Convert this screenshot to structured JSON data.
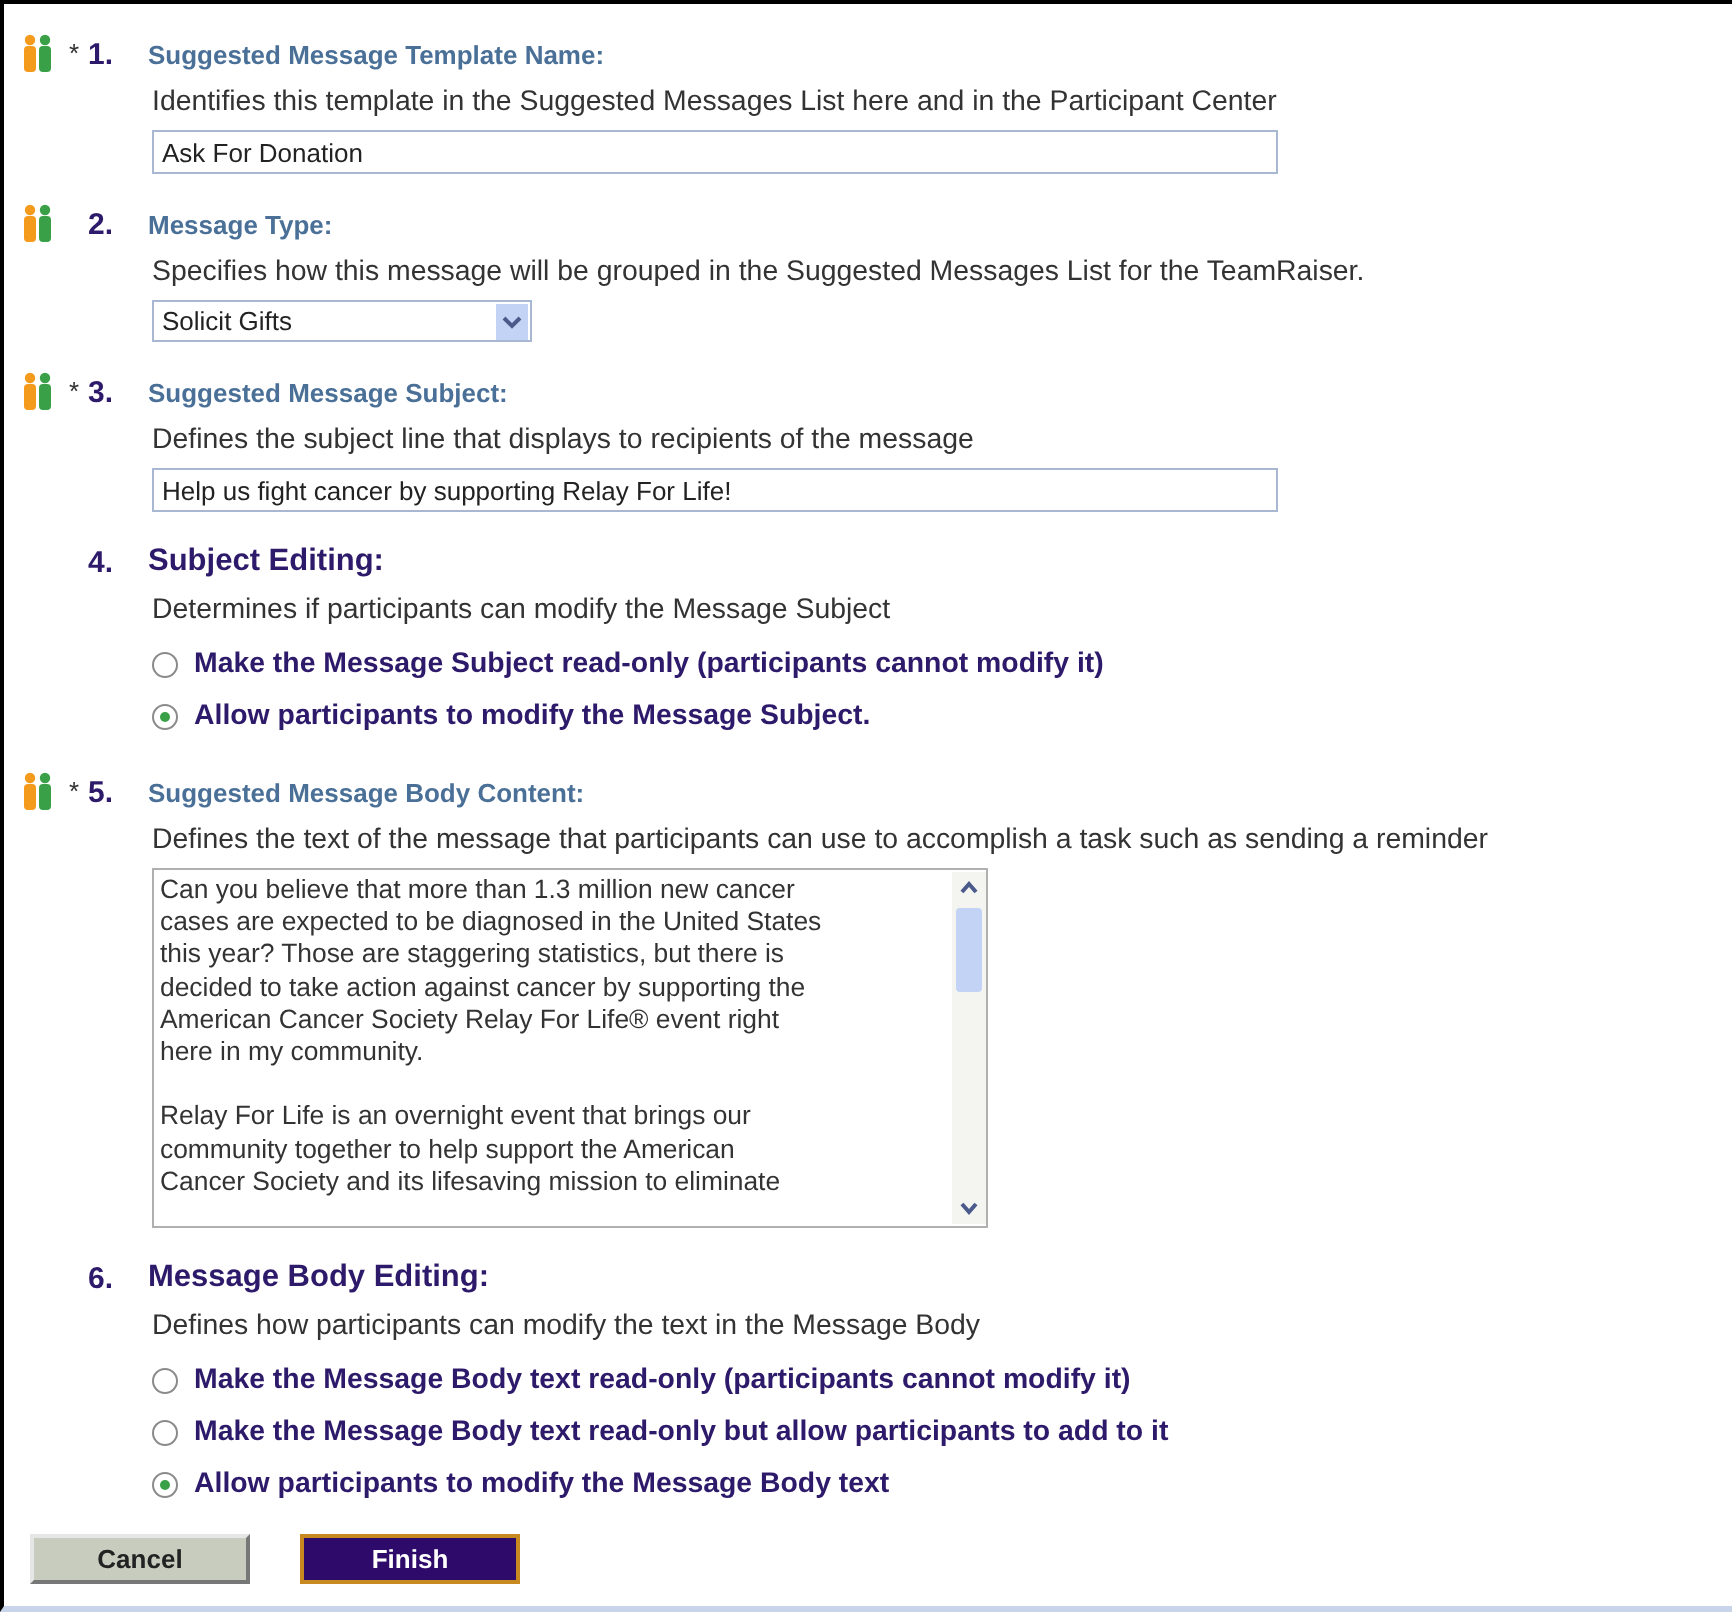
{
  "sections": [
    {
      "kind": "text",
      "icon": true,
      "required_mark": "*",
      "number": "1.",
      "title": "Suggested Message Template Name:",
      "title_large": false,
      "description": "Identifies this template in the Suggested Messages List here and in the Participant Center",
      "value": "Ask For Donation"
    },
    {
      "kind": "select",
      "icon": true,
      "number": "2.",
      "title": "Message Type:",
      "title_large": false,
      "description": "Specifies how this message will be grouped in the Suggested Messages List for the TeamRaiser.",
      "value": "Solicit Gifts"
    },
    {
      "kind": "text",
      "icon": true,
      "required_mark": "*",
      "number": "3.",
      "title": "Suggested Message Subject:",
      "title_large": false,
      "description": "Defines the subject line that displays to recipients of the message",
      "value": "Help us fight cancer by supporting Relay For Life!"
    },
    {
      "kind": "radios",
      "icon": false,
      "number": "4.",
      "title": "Subject Editing:",
      "title_large": true,
      "description": "Determines if participants can modify the Message Subject",
      "options": [
        {
          "label": "Make the Message Subject read-only (participants cannot modify it)",
          "selected": false
        },
        {
          "label": "Allow participants to modify the Message Subject.",
          "selected": true
        }
      ]
    },
    {
      "kind": "textarea",
      "icon": true,
      "required_mark": "*",
      "number": "5.",
      "title": "Suggested Message Body Content:",
      "title_large": false,
      "description": "Defines the text of the message that participants can use to accomplish a task such as sending a reminder",
      "value": "Can you believe that more than 1.3 million new cancer\ncases are expected to be diagnosed in the United States\nthis year? Those are staggering statistics, but there is\ndecided to take action against cancer by supporting the\nAmerican Cancer Society Relay For Life® event right\nhere in my community.\n\nRelay For Life is an overnight event that brings our\ncommunity together to help support the American\nCancer Society and its lifesaving mission to eliminate"
    },
    {
      "kind": "radios",
      "icon": false,
      "number": "6.",
      "title": "Message Body Editing:",
      "title_large": true,
      "description": "Defines how participants can modify the text in the Message Body",
      "options": [
        {
          "label": "Make the Message Body text read-only (participants cannot modify it)",
          "selected": false
        },
        {
          "label": "Make the Message Body text read-only but allow participants to add to it",
          "selected": false
        },
        {
          "label": "Allow participants to modify the Message Body text",
          "selected": true
        }
      ]
    }
  ],
  "buttons": [
    {
      "label": "Cancel",
      "kind": "secondary"
    },
    {
      "label": "Finish",
      "kind": "primary"
    }
  ]
}
